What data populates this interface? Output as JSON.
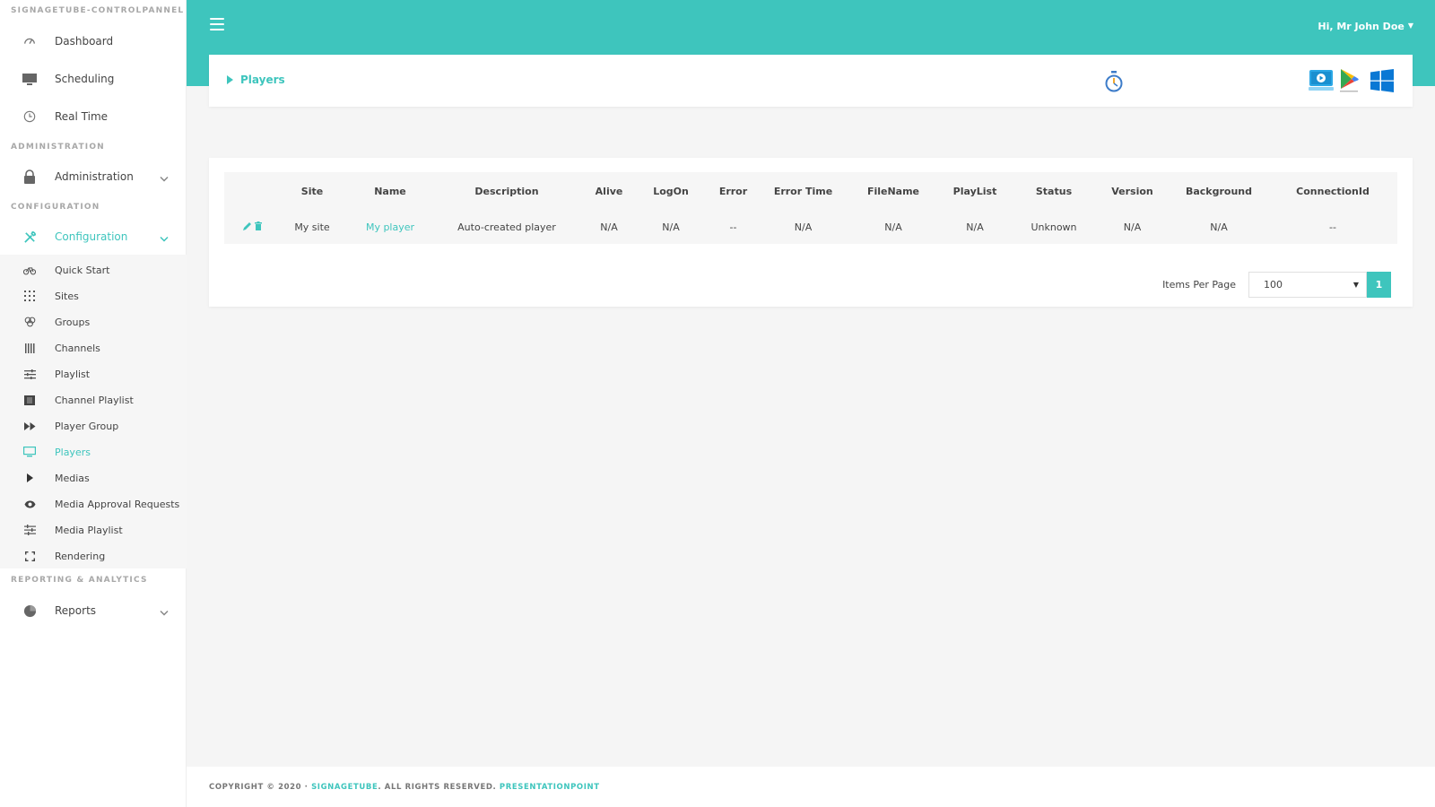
{
  "app": {
    "name": "SIGNAGETUBE-CONTROLPANNEL"
  },
  "sidebar": {
    "sections": {
      "administration": "ADMINISTRATION",
      "configuration": "CONFIGURATION",
      "reporting": "REPORTING & ANALYTICS"
    },
    "top_items": [
      {
        "label": "Dashboard",
        "icon": "gauge-icon"
      },
      {
        "label": "Scheduling",
        "icon": "monitor-icon"
      },
      {
        "label": "Real Time",
        "icon": "clock-icon"
      }
    ],
    "administration": {
      "label": "Administration",
      "icon": "lock-icon"
    },
    "configuration": {
      "label": "Configuration",
      "icon": "tools-icon"
    },
    "config_items": [
      {
        "label": "Quick Start",
        "icon": "bicycle-icon"
      },
      {
        "label": "Sites",
        "icon": "grid-icon"
      },
      {
        "label": "Groups",
        "icon": "circles-icon"
      },
      {
        "label": "Channels",
        "icon": "bars-icon"
      },
      {
        "label": "Playlist",
        "icon": "sliders-icon"
      },
      {
        "label": "Channel Playlist",
        "icon": "film-icon"
      },
      {
        "label": "Player Group",
        "icon": "fast-forward-icon"
      },
      {
        "label": "Players",
        "icon": "desktop-icon"
      },
      {
        "label": "Medias",
        "icon": "play-icon"
      },
      {
        "label": "Media Approval Requests",
        "icon": "eye-icon"
      },
      {
        "label": "Media Playlist",
        "icon": "equalizer-icon"
      },
      {
        "label": "Rendering",
        "icon": "expand-icon"
      }
    ],
    "reports": {
      "label": "Reports",
      "icon": "pie-chart-icon"
    }
  },
  "header": {
    "user_greeting": "Hi, Mr John Doe"
  },
  "breadcrumb": {
    "label": "Players"
  },
  "table": {
    "columns": [
      "",
      "Site",
      "Name",
      "Description",
      "Alive",
      "LogOn",
      "Error",
      "Error Time",
      "FileName",
      "PlayList",
      "Status",
      "Version",
      "Background",
      "ConnectionId"
    ],
    "rows": [
      {
        "site": "My site",
        "name": "My player",
        "description": "Auto-created player",
        "alive": "N/A",
        "logon": "N/A",
        "error": "--",
        "error_time": "N/A",
        "filename": "N/A",
        "playlist": "N/A",
        "status": "Unknown",
        "version": "N/A",
        "background": "N/A",
        "connection_id": "--"
      }
    ]
  },
  "pagination": {
    "items_per_page_label": "Items Per Page",
    "items_per_page_value": "100",
    "current_page": "1"
  },
  "footer": {
    "copyright": "COPYRIGHT © 2020 ·",
    "brand": "SIGNAGETUBE",
    "rights": ". ALL RIGHTS RESERVED.",
    "company": "PRESENTATIONPOINT"
  },
  "colors": {
    "accent": "#3ec5bd"
  }
}
